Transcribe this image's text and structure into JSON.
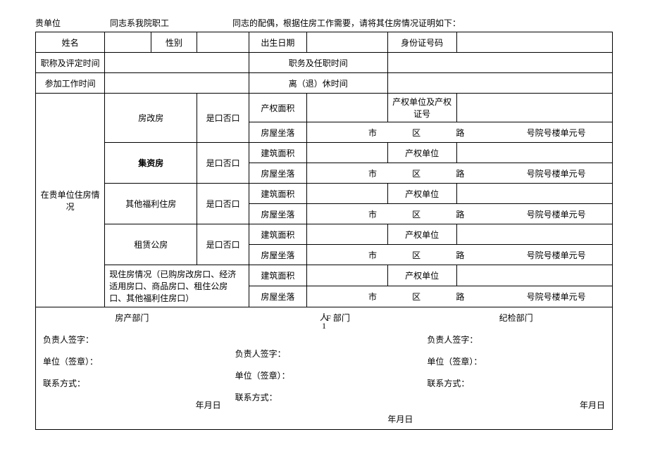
{
  "preamble": {
    "p1": "贵单位",
    "p2": "同志系我院职工",
    "p3": "同志的配偶，根据住房工作需要，请将其住房情况证明如下："
  },
  "row1": {
    "name": "姓名",
    "gender": "性别",
    "dob": "出生日期",
    "id": "身份证号码"
  },
  "row2": {
    "title_time": "职称及评定时间",
    "duty_time": "职务及任职时间"
  },
  "row3": {
    "work_time": "参加工作时间",
    "retire_time": "离（退）休时间"
  },
  "sideLabel": "在贵单位住房情\n况",
  "types": {
    "fgf": "房改房",
    "jzf": "集资房",
    "qtfl": "其他福利住房",
    "zlgf": "租赁公房",
    "current": "现住房情况（已购房改房口、经济适用房口、商品房口、租住公房口、其他福利住房口）"
  },
  "yesno": "是口否口",
  "yesno2": "是口否口",
  "fields": {
    "cqmj": "产权面积",
    "cqdw_zh": "产权单位及产权证号",
    "fwzl": "房屋坐落",
    "jzmj": "建筑面积",
    "cqdw": "产权单位"
  },
  "addr": {
    "shi": "市",
    "qu": "区",
    "lu": "路",
    "hao": "号院号楼单元号"
  },
  "sig": {
    "dept1": "房产部门",
    "dept2_float": "人\n1",
    "dept2_suffix": "F 部门",
    "dept3": "纪检部门",
    "l1": "负责人签字：",
    "l2": "单位（签章）：",
    "l3": "联系方式：",
    "date": "年月日"
  }
}
